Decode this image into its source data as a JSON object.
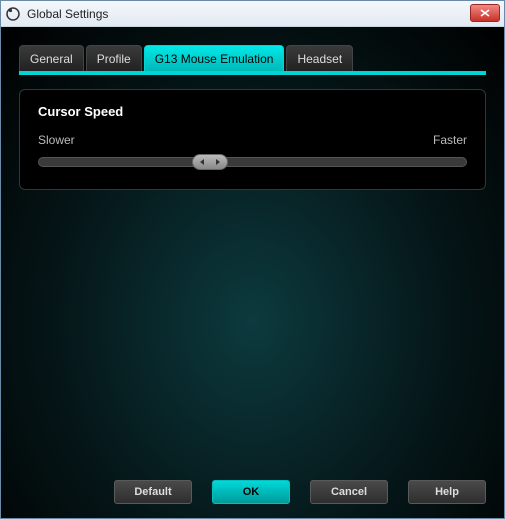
{
  "window": {
    "title": "Global Settings"
  },
  "tabs": {
    "general": "General",
    "profile": "Profile",
    "mouse": "G13 Mouse Emulation",
    "headset": "Headset",
    "active_index": 2
  },
  "panel": {
    "title": "Cursor Speed",
    "slower_label": "Slower",
    "faster_label": "Faster",
    "slider_percent": 40
  },
  "buttons": {
    "default": "Default",
    "ok": "OK",
    "cancel": "Cancel",
    "help": "Help"
  },
  "colors": {
    "accent": "#00d4d4"
  }
}
